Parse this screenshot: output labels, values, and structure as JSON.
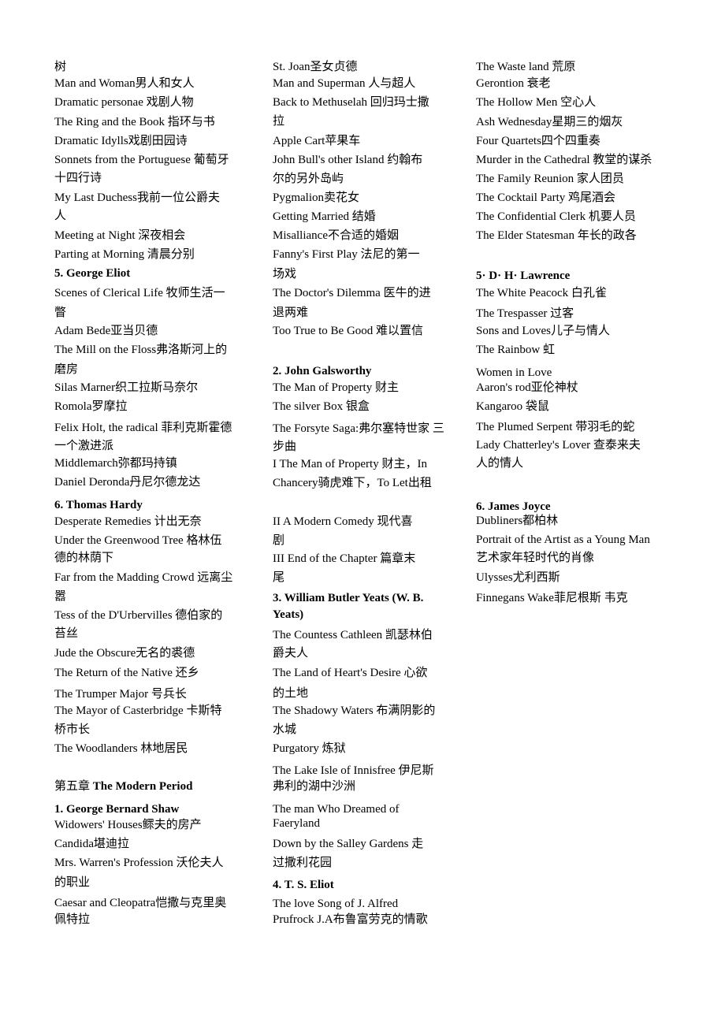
{
  "columns": [
    {
      "lines": [
        {
          "t": "树"
        },
        {
          "t": "Man and Woman男人和女人"
        },
        {
          "t": "Dramatic personae 戏剧人物"
        },
        {
          "t": "The Ring and the Book 指环与书"
        },
        {
          "t": "Dramatic Idylls戏剧田园诗"
        },
        {
          "t": "Sonnets from the Portuguese 葡萄牙"
        },
        {
          "t": "十四行诗"
        },
        {
          "t": "My Last Duchess我前一位公爵夫"
        },
        {
          "t": "人"
        },
        {
          "t": "Meeting at Night 深夜相会"
        },
        {
          "t": "Parting at Morning 清晨分别"
        },
        {
          "t": "5. George Eliot",
          "b": true
        },
        {
          "t": "Scenes of Clerical Life 牧师生活一"
        },
        {
          "t": "瞥"
        },
        {
          "t": "Adam Bede亚当贝德"
        },
        {
          "t": "The Mill on the Floss弗洛斯河上的"
        },
        {
          "t": "磨房"
        },
        {
          "t": "Silas Marner织工拉斯马奈尔"
        },
        {
          "t": "Romola罗摩拉"
        },
        {
          "t": "Felix Holt, the radical 菲利克斯霍德"
        },
        {
          "t": "一个激进派"
        },
        {
          "t": "Middlemarch弥都玛持镇"
        },
        {
          "t": "Daniel Deronda丹尼尔德龙达"
        },
        {
          "t": "6.   Thomas Hardy",
          "b": true
        },
        {
          "t": "Desperate Remedies 计出无奈"
        },
        {
          "t": "Under the Greenwood Tree 格林伍"
        },
        {
          "t": "德的林荫下"
        },
        {
          "t": "Far from the Madding Crowd 远离尘"
        },
        {
          "t": "嚣"
        },
        {
          "t": "Tess of the D'Urbervilles 德伯家的"
        },
        {
          "t": "苔丝"
        },
        {
          "t": "Jude the Obscure无名的裘德"
        },
        {
          "t": "The Return of the Native 还乡"
        },
        {
          "t": "The Trumper Major 号兵长"
        },
        {
          "t": "The Mayor of Casterbridge 卡斯特"
        },
        {
          "t": "桥市长"
        },
        {
          "t": "The Woodlanders 林地居民"
        },
        {
          "t": "第五章  ",
          "t2": "The Modern Period"
        },
        {
          "t": "1. George Bernard Shaw",
          "b": true
        },
        {
          "t": "Widowers' Houses鳏夫的房产"
        },
        {
          "t": "Candida堪迪拉"
        },
        {
          "t": "Mrs. Warren's Profession 沃伦夫人"
        },
        {
          "t": "的职业"
        },
        {
          "t": "Caesar and Cleopatra恺撒与克里奥"
        },
        {
          "t": "佩特拉"
        }
      ]
    },
    {
      "lines": [
        {
          "t": "St. Joan圣女贞德"
        },
        {
          "t": "Man and Superman 人与超人"
        },
        {
          "t": "Back to Methuselah 回归玛士撒"
        },
        {
          "t": "拉"
        },
        {
          "t": "Apple Cart苹果车"
        },
        {
          "t": "John Bull's other Island 约翰布"
        },
        {
          "t": "尔的另外岛屿"
        },
        {
          "t": "Pygmalion卖花女"
        },
        {
          "t": "Getting Married 结婚"
        },
        {
          "t": "Misalliance不合适的婚姻"
        },
        {
          "t": "Fanny's First Play 法尼的第一"
        },
        {
          "t": "场戏"
        },
        {
          "t": "The Doctor's Dilemma 医牛的进"
        },
        {
          "t": "退两难"
        },
        {
          "t": "Too True to Be Good 难以置信"
        },
        {
          "t": "2.   John Galsworthy",
          "b": true
        },
        {
          "t": "The Man of Property 财主"
        },
        {
          "t": "The silver Box 银盒"
        },
        {
          "t": "The  Forsyte  Saga:弗尔塞特世家   三"
        },
        {
          "t": "步曲"
        },
        {
          "t": " I The Man of Property 财主，In"
        },
        {
          "t": "Chancery骑虎难下，To Let出租"
        },
        {
          "t": " II A Modern Comedy 现代喜"
        },
        {
          "t": "剧"
        },
        {
          "t": "III End of the Chapter 篇章末"
        },
        {
          "t": "尾"
        },
        {
          "t": "3.   William Butler Yeats (W. B.",
          "b": true
        },
        {
          "t": "Yeats)",
          "b": true
        },
        {
          "t": "The Countess Cathleen 凯瑟林伯"
        },
        {
          "t": "爵夫人"
        },
        {
          "t": "The Land of Heart's Desire 心欲"
        },
        {
          "t": "的土地"
        },
        {
          "t": "The Shadowy Waters 布满阴影的"
        },
        {
          "t": "水城"
        },
        {
          "t": "Purgatory 炼狱"
        },
        {
          "t": "The Lake Isle of Innisfree 伊尼斯"
        },
        {
          "t": "弗利的湖中沙洲"
        },
        {
          "t": "The man Who Dreamed of"
        },
        {
          "t": "Faeryland"
        },
        {
          "t": "Down by the Salley Gardens 走"
        },
        {
          "t": "过撒利花园"
        },
        {
          "t": "4. T. S. Eliot",
          "b": true
        },
        {
          "t": "The love Song of J. Alfred"
        },
        {
          "t": "Prufrock J.A布鲁富劳克的情歌"
        }
      ]
    },
    {
      "lines": [
        {
          "t": "The Waste land 荒原"
        },
        {
          "t": "Gerontion 衰老"
        },
        {
          "t": "The Hollow Men 空心人"
        },
        {
          "t": "Ash Wednesday星期三的烟灰"
        },
        {
          "t": "Four Quartets四个四重奏"
        },
        {
          "t": "Murder in the Cathedral 教堂的谋杀"
        },
        {
          "t": "The Family Reunion 家人团员"
        },
        {
          "t": "The Cocktail Party 鸡尾酒会"
        },
        {
          "t": "The Confidential Clerk 机要人员"
        },
        {
          "t": "The Elder Statesman 年长的政各"
        },
        {
          "t": "5· D· H· Lawrence",
          "b": true
        },
        {
          "t": "The White Peacock 白孔雀"
        },
        {
          "t": "The Trespasser 过客"
        },
        {
          "t": "Sons and Loves儿子与情人"
        },
        {
          "t": "The Rainbow 虹"
        },
        {
          "t": "Women in Love"
        },
        {
          "t": "Aaron's rod亚伦神杖"
        },
        {
          "t": "Kangaroo 袋鼠"
        },
        {
          "t": "The Plumed Serpent 带羽毛的蛇"
        },
        {
          "t": "Lady Chatterley's Lover 查泰来夫"
        },
        {
          "t": "人的情人"
        },
        {
          "t": "6. James Joyce",
          "b": true
        },
        {
          "t": "Dubliners都柏林"
        },
        {
          "t": "Portrait of the Artist as a Young Man"
        },
        {
          "t": "艺术家年轻时代的肖像"
        },
        {
          "t": "Ulysses尤利西斯"
        },
        {
          "t": "Finnegans Wake菲尼根斯  韦克"
        }
      ]
    }
  ]
}
